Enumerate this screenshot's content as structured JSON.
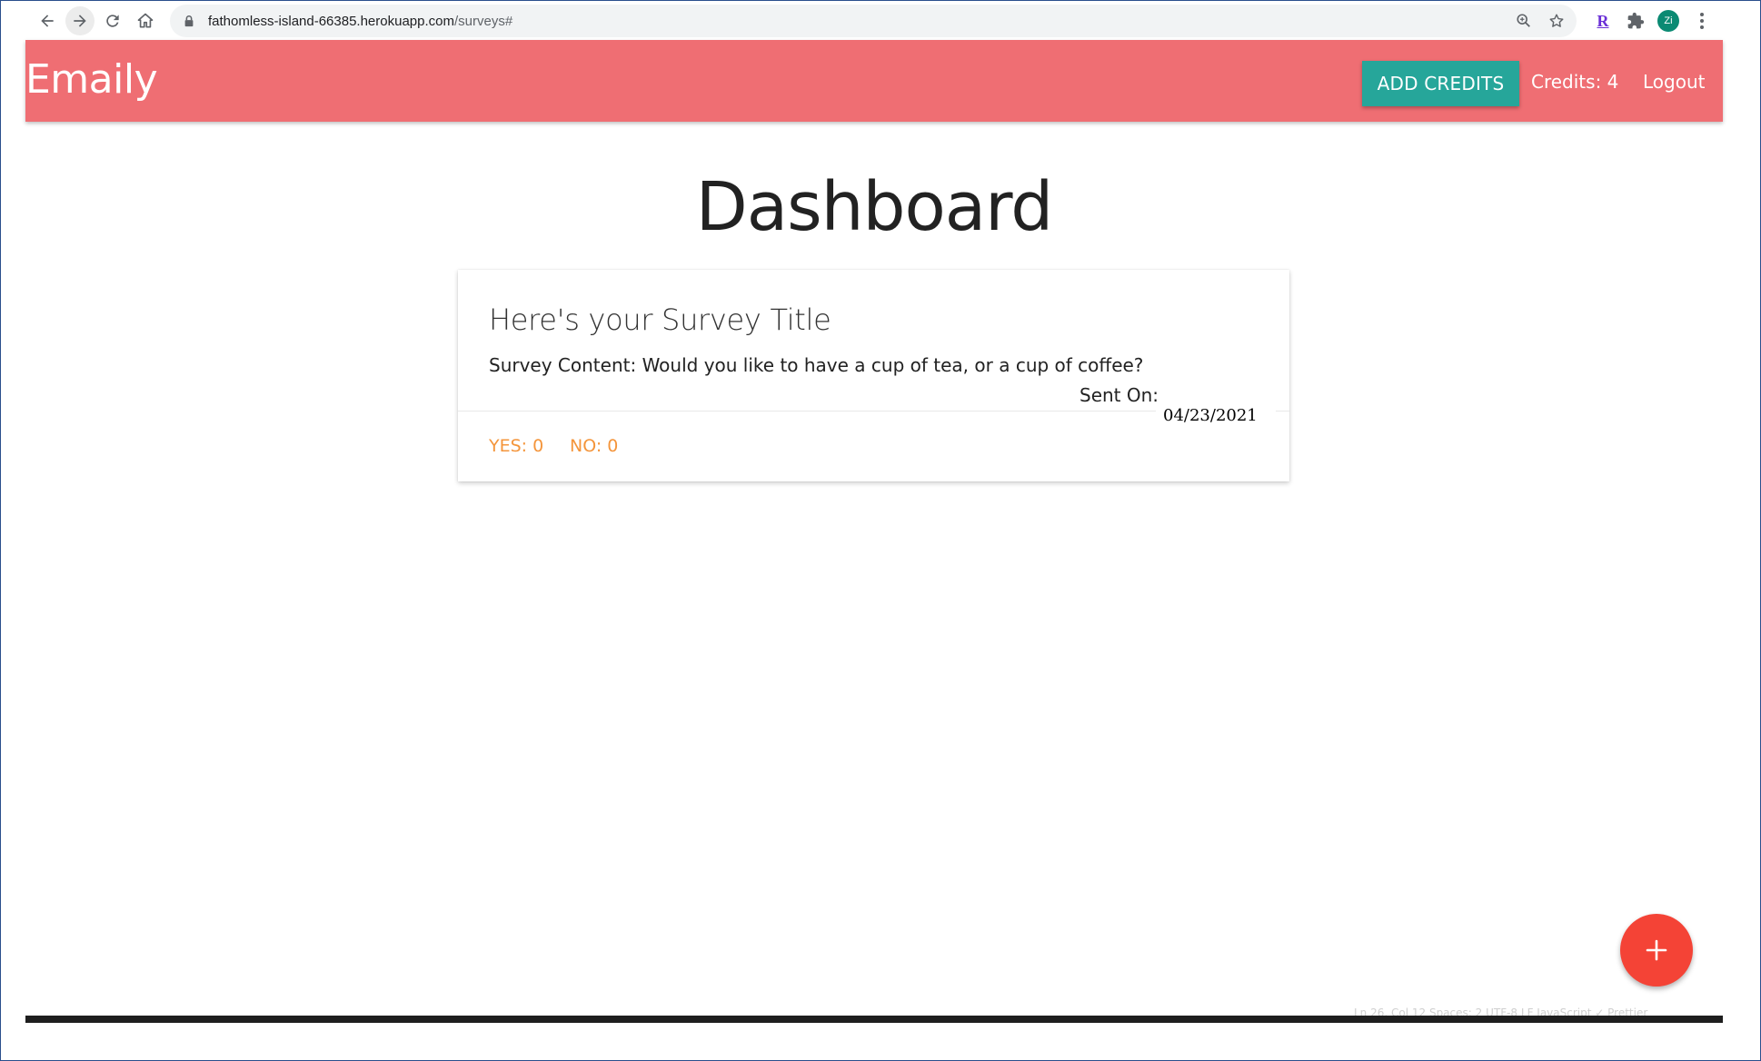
{
  "browser": {
    "url_host": "fathomless-island-66385.herokuapp.com",
    "url_path": "/surveys#",
    "profile_initials": "Zi",
    "extension_letter": "R"
  },
  "navbar": {
    "brand": "Emaily",
    "add_credits_label": "ADD CREDITS",
    "credits_text": "Credits: 4",
    "logout_label": "Logout",
    "background_color": "#ef6e73",
    "button_color": "#26a69a"
  },
  "page": {
    "title": "Dashboard"
  },
  "surveys": [
    {
      "title": "Here's your Survey Title",
      "content": "Survey Content: Would you like to have a cup of tea, or a cup of coffee?",
      "sent_on_label": "Sent On:",
      "sent_on_date": "04/23/2021",
      "yes_text": "YES: 0",
      "no_text": "NO: 0"
    }
  ],
  "fab": {
    "icon": "plus-icon",
    "color": "#f44336"
  },
  "status_bar": {
    "text": "Ln 26, Col 12    Spaces: 2    UTF-8    LF    JavaScript    ✓ Prettier"
  }
}
